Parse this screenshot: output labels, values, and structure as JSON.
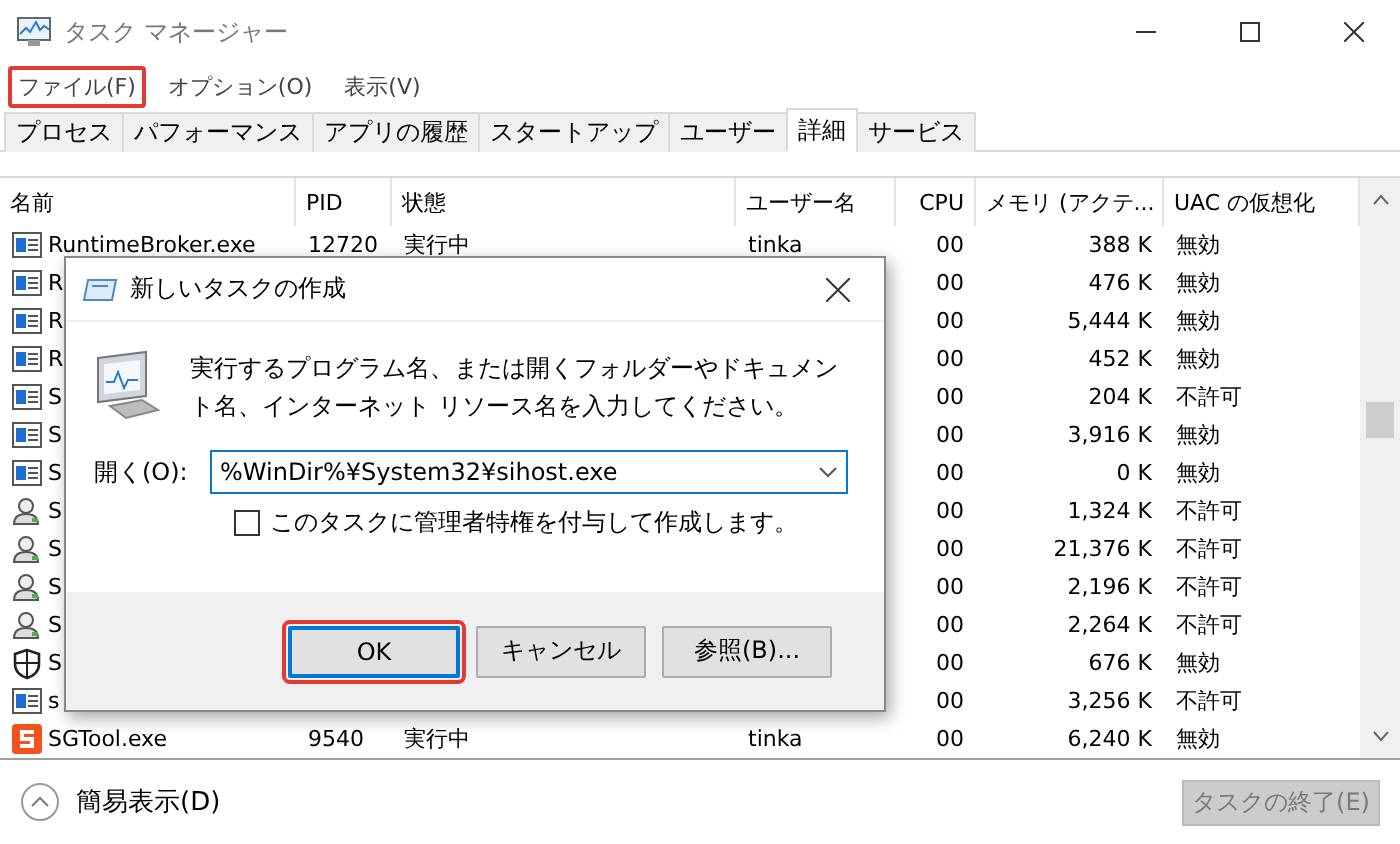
{
  "window": {
    "title": "タスク マネージャー"
  },
  "menu": [
    {
      "label": "ファイル(F)",
      "highlighted": true
    },
    {
      "label": "オプション(O)",
      "highlighted": false
    },
    {
      "label": "表示(V)",
      "highlighted": false
    }
  ],
  "tabs": [
    {
      "label": "プロセス",
      "selected": false
    },
    {
      "label": "パフォーマンス",
      "selected": false
    },
    {
      "label": "アプリの履歴",
      "selected": false
    },
    {
      "label": "スタートアップ",
      "selected": false
    },
    {
      "label": "ユーザー",
      "selected": false
    },
    {
      "label": "詳細",
      "selected": true
    },
    {
      "label": "サービス",
      "selected": false
    }
  ],
  "table": {
    "columns": [
      "名前",
      "PID",
      "状態",
      "ユーザー名",
      "CPU",
      "メモリ (アクテ...",
      "UAC の仮想化"
    ],
    "rows": [
      {
        "kind": "app",
        "name": "RuntimeBroker.exe",
        "pid": "12720",
        "status": "実行中",
        "user": "tinka",
        "cpu": "00",
        "memory": "388 K",
        "uac": "無効"
      },
      {
        "kind": "app",
        "name": "R",
        "cpu": "00",
        "memory": "476 K",
        "uac": "無効"
      },
      {
        "kind": "app",
        "name": "R",
        "cpu": "00",
        "memory": "5,444 K",
        "uac": "無効"
      },
      {
        "kind": "app",
        "name": "R",
        "cpu": "00",
        "memory": "452 K",
        "uac": "無効"
      },
      {
        "kind": "app",
        "name": "S",
        "cpu": "00",
        "memory": "204 K",
        "uac": "不許可"
      },
      {
        "kind": "app",
        "name": "S",
        "cpu": "00",
        "memory": "3,916 K",
        "uac": "無効"
      },
      {
        "kind": "app",
        "name": "S",
        "cpu": "00",
        "memory": "0 K",
        "uac": "無効"
      },
      {
        "kind": "user",
        "name": "S",
        "cpu": "00",
        "memory": "1,324 K",
        "uac": "不許可"
      },
      {
        "kind": "user",
        "name": "S",
        "cpu": "00",
        "memory": "21,376 K",
        "uac": "不許可"
      },
      {
        "kind": "user",
        "name": "S",
        "cpu": "00",
        "memory": "2,196 K",
        "uac": "不許可"
      },
      {
        "kind": "user",
        "name": "S",
        "cpu": "00",
        "memory": "2,264 K",
        "uac": "不許可"
      },
      {
        "kind": "shield",
        "name": "S",
        "cpu": "00",
        "memory": "676 K",
        "uac": "無効"
      },
      {
        "kind": "app",
        "name": "s",
        "cpu": "00",
        "memory": "3,256 K",
        "uac": "不許可"
      },
      {
        "kind": "sgtool",
        "name": "SGTool.exe",
        "pid": "9540",
        "status": "実行中",
        "user": "tinka",
        "cpu": "00",
        "memory": "6,240 K",
        "uac": "無効"
      }
    ]
  },
  "footer": {
    "toggle": "簡易表示(D)",
    "end_task": {
      "label": "タスクの終了(E)",
      "disabled": true
    }
  },
  "dialog": {
    "title": "新しいタスクの作成",
    "message": "実行するプログラム名、または開くフォルダーやドキュメント名、インターネット リソース名を入力してください。",
    "open_label": "開く(O):",
    "open_value": "%WinDir%¥System32¥sihost.exe",
    "admin_checkbox": {
      "label": "このタスクに管理者特権を付与して作成します。",
      "checked": false
    },
    "buttons": [
      {
        "label": "OK",
        "highlighted": true
      },
      {
        "label": "キャンセル",
        "highlighted": false
      },
      {
        "label": "参照(B)...",
        "highlighted": false
      }
    ]
  }
}
